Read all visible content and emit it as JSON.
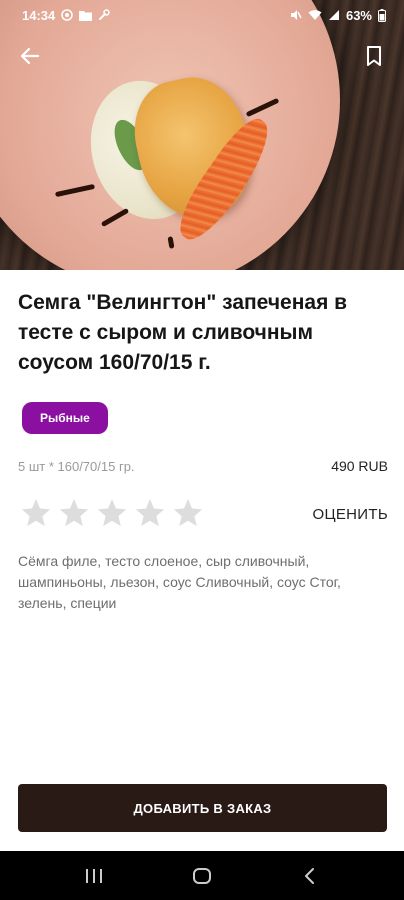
{
  "status_bar": {
    "time": "14:34",
    "battery": "63%",
    "left_icons": [
      "location-icon",
      "folder-icon",
      "wrench-icon"
    ],
    "right_icons": [
      "mute-icon",
      "wifi-icon",
      "signal-icon",
      "battery-icon"
    ]
  },
  "app_bar": {
    "back_icon": "arrow-back-icon",
    "bookmark_icon": "bookmark-icon"
  },
  "dish": {
    "title": "Семга \"Велингтон\" запеченая в тесте с сыром и сливочным соусом 160/70/15 г.",
    "category": "Рыбные",
    "portion": "5 шт * 160/70/15 гр.",
    "price": "490 RUB",
    "rating": {
      "max": 5,
      "value": 0,
      "rate_label": "ОЦЕНИТЬ"
    },
    "ingredients": "Сёмга филе, тесто слоеное, сыр сливочный, шампиньоны, льезон, соус Сливочный, соус Стог, зелень, специи"
  },
  "actions": {
    "add_to_order": "ДОБАВИТЬ В ЗАКАЗ"
  },
  "colors": {
    "category_chip": "#8b0fa0",
    "primary_button": "#2a1a16",
    "star_inactive": "#dddddd"
  },
  "nav_bar": {
    "buttons": [
      "recents-icon",
      "home-icon",
      "back-icon"
    ]
  }
}
